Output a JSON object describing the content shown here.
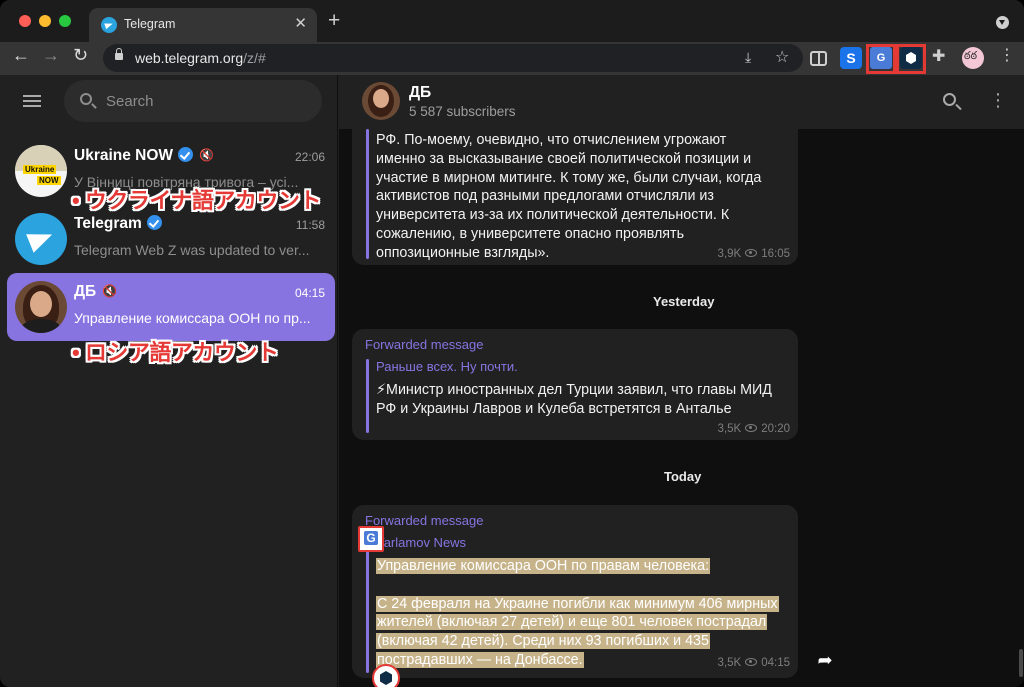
{
  "browser": {
    "tab_title": "Telegram",
    "tab_close": "✕",
    "new_tab": "+",
    "url_host": "web.telegram.org",
    "url_path": "/z/#",
    "nav": {
      "back": "←",
      "forward": "→",
      "reload": "↻"
    },
    "omnibox_icons": {
      "download": "⤓",
      "star": "☆"
    },
    "extensions": {
      "s_label": "S",
      "translate_label": "G",
      "puzzle": "✚"
    },
    "menu": "⋮"
  },
  "sidebar": {
    "search_placeholder": "Search",
    "chats": [
      {
        "name": "Ukraine NOW",
        "time": "22:06",
        "preview": "У Вінниці повітряна тривога – усі...",
        "verified": true,
        "muted": true,
        "avatar_text_1": "Ukraine",
        "avatar_text_2": "NOW"
      },
      {
        "name": "Telegram",
        "time": "11:58",
        "preview": "Telegram Web Z was updated to ver...",
        "verified": true,
        "muted": false
      },
      {
        "name": "ДБ",
        "time": "04:15",
        "preview": "Управление комиссара ООН по пр...",
        "verified": false,
        "muted": true,
        "active": true
      }
    ],
    "mute_glyph": "🔇"
  },
  "annotations": {
    "ukrainian": "• ウクライナ語アカウント",
    "russian": "• ロシア語アカウント"
  },
  "channel": {
    "name": "ДБ",
    "subscribers": "5 587 subscribers",
    "more_glyph": "⋮"
  },
  "messages": [
    {
      "text_lines": [
        "РФ. По-моему, очевидно, что отчислением угрожают",
        "именно за высказывание своей политической позиции и",
        "участие в мирном митинге. К тому же, были случаи, когда",
        "активистов под разными предлогами отчисляли из",
        "университета из-за их политической деятельности. К",
        "сожалению, в университете опасно проявлять",
        "оппозиционные взгляды»."
      ],
      "views": "3,9K",
      "time": "16:05"
    },
    {
      "forwarded_label": "Forwarded message",
      "source": "Раньше всех. Ну почти.",
      "text_lines": [
        "⚡Министр иностранных дел Турции заявил, что главы МИД",
        "РФ и Украины Лавров и Кулеба встретятся в Анталье"
      ],
      "views": "3,5K",
      "time": "20:20"
    },
    {
      "forwarded_label": "Forwarded message",
      "source": "Varlamov News",
      "text_lines": [
        "Управление комиссара ООН по правам человека:",
        "",
        "С 24 февраля на Украине погибли как минимум 406 мирных",
        "жителей (включая 27 детей) и еще 801 человек пострадал",
        "(включая 42 детей). Среди них 93 погибших и 435",
        "пострадавших — на Донбассе."
      ],
      "views": "3,5K",
      "time": "04:15"
    }
  ],
  "date_separators": {
    "yesterday": "Yesterday",
    "today": "Today"
  },
  "share_glyph": "➦",
  "colors": {
    "accent": "#8774e1",
    "highlight_box": "#e53935",
    "telegram_blue": "#2aa3df"
  }
}
